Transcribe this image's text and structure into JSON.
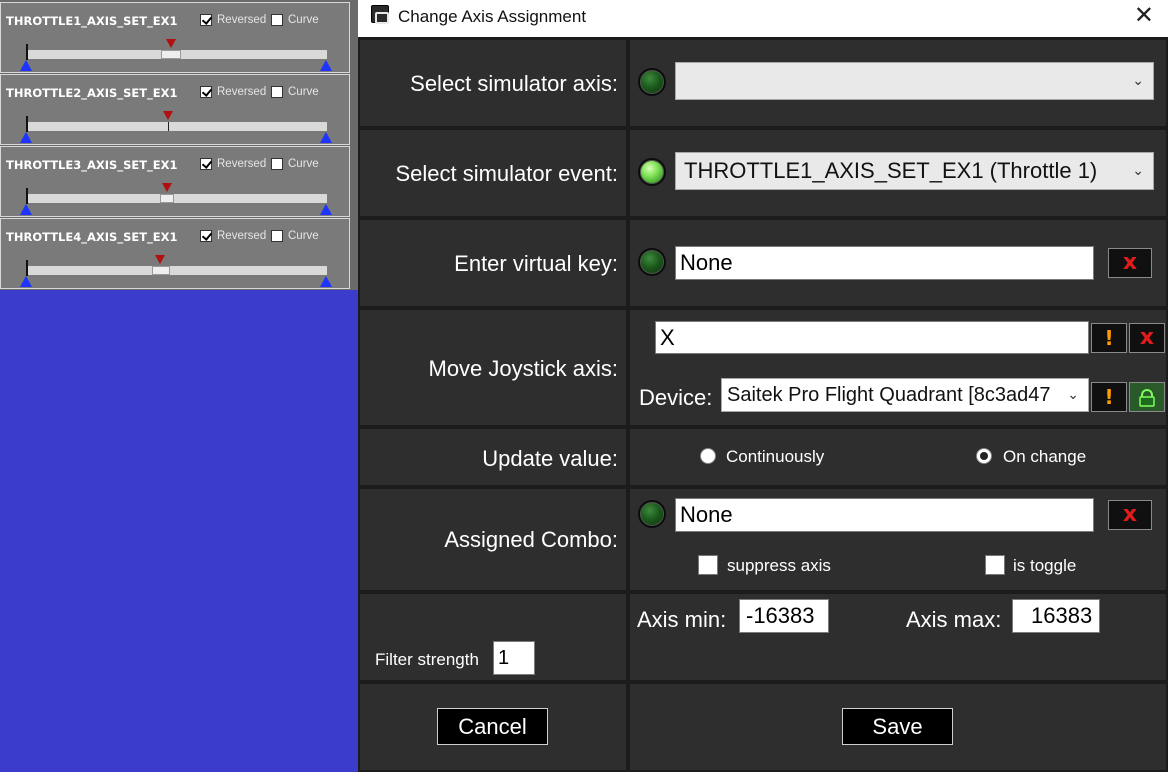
{
  "axis_panel": {
    "rows": [
      {
        "name": "THROTTLE1_AXIS_SET_EX1",
        "reversed": true,
        "curve": false,
        "reversed_label": "Reversed",
        "curve_label": "Curve"
      },
      {
        "name": "THROTTLE2_AXIS_SET_EX1",
        "reversed": true,
        "curve": false,
        "reversed_label": "Reversed",
        "curve_label": "Curve"
      },
      {
        "name": "THROTTLE3_AXIS_SET_EX1",
        "reversed": true,
        "curve": false,
        "reversed_label": "Reversed",
        "curve_label": "Curve"
      },
      {
        "name": "THROTTLE4_AXIS_SET_EX1",
        "reversed": true,
        "curve": false,
        "reversed_label": "Reversed",
        "curve_label": "Curve"
      }
    ],
    "colors": {
      "marker": "#b01010",
      "range_marker": "#1f33ff"
    }
  },
  "dialog": {
    "title": "Change Axis Assignment",
    "close_glyph": "✕",
    "simulator_axis": {
      "label": "Select simulator axis:",
      "value": "",
      "led_on": false
    },
    "simulator_event": {
      "label": "Select simulator event:",
      "value": "THROTTLE1_AXIS_SET_EX1 (Throttle 1)",
      "led_on": true
    },
    "virtual_key": {
      "label": "Enter virtual key:",
      "value": "None",
      "led_on": false,
      "clear_glyph": "x"
    },
    "joystick_axis": {
      "label": "Move Joystick axis:",
      "value": "X",
      "warn_glyph": "!",
      "clear_glyph": "x",
      "device_label": "Device:",
      "device_value": "Saitek Pro Flight Quadrant [8c3ad47",
      "lock_icon": "lock-icon"
    },
    "update_value": {
      "label": "Update value:",
      "options": [
        "Continuously",
        "On change"
      ],
      "selected": "On change"
    },
    "assigned_combo": {
      "label": "Assigned Combo:",
      "value": "None",
      "led_on": false,
      "clear_glyph": "x",
      "suppress_label": "suppress axis",
      "suppress_checked": false,
      "toggle_label": "is toggle",
      "toggle_checked": false
    },
    "range": {
      "filter_label": "Filter strength",
      "filter_value": "1",
      "min_label": "Axis min:",
      "min_value": "-16383",
      "max_label": "Axis max:",
      "max_value": "16383"
    },
    "buttons": {
      "cancel": "Cancel",
      "save": "Save"
    },
    "colors": {
      "background": "#1c1c1c",
      "cell": "#2e2e2e",
      "accent_red": "#e01c1c",
      "accent_orange": "#ff9c00",
      "led_on": "#86e45a"
    }
  }
}
